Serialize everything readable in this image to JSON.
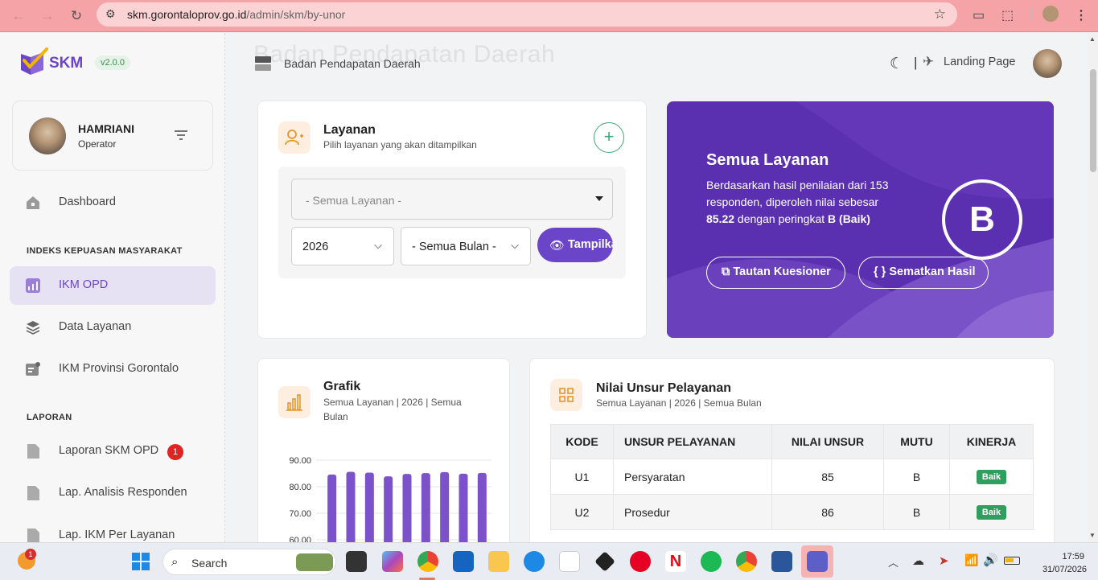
{
  "browser": {
    "url_host": "skm.gorontaloprov.go.id",
    "url_path": "/admin/skm/by-unor"
  },
  "sidebar": {
    "logo_text": "SKM",
    "version": "v2.0.0",
    "user": {
      "name": "HAMRIANI",
      "role": "Operator"
    },
    "items": [
      {
        "label": "Dashboard",
        "icon": "home-icon"
      },
      {
        "label": "IKM OPD",
        "icon": "chart-icon"
      },
      {
        "label": "Data Layanan",
        "icon": "layers-icon"
      },
      {
        "label": "IKM Provinsi Gorontalo",
        "icon": "doc-icon"
      },
      {
        "label": "Laporan SKM OPD",
        "icon": "file-icon",
        "badge": "1"
      },
      {
        "label": "Lap. Analisis Responden",
        "icon": "file-icon"
      },
      {
        "label": "Lap. IKM Per Layanan",
        "icon": "file-icon"
      }
    ],
    "section_ikm": "INDEKS KEPUASAN MASYARAKAT",
    "section_laporan": "LAPORAN"
  },
  "topbar": {
    "org_name": "Badan Pendapatan Daerah",
    "separator": "|",
    "landing_label": "Landing Page"
  },
  "layanan": {
    "title": "Layanan",
    "subtitle": "Pilih layanan yang akan ditampilkan",
    "add_symbol": "+",
    "service_select": "- Semua Layanan -",
    "year_select": "2026",
    "month_select": "- Semua Bulan -",
    "show_button": "Tampilkan"
  },
  "hero": {
    "title": "Semua Layanan",
    "text_1": "Berdasarkan hasil penilaian dari 153 responden, diperoleh nilai sebesar ",
    "score": "85.22",
    "text_2": " dengan peringkat ",
    "grade_text": "B (Baik)",
    "grade": "B",
    "button_kuesioner": "Tautan Kuesioner",
    "button_sematkan": "Sematkan Hasil",
    "accent": "#5a2fb0"
  },
  "grafik": {
    "title": "Grafik",
    "subtitle": "Semua Layanan | 2026 | Semua Bulan"
  },
  "chart_data": {
    "type": "bar",
    "y_ticks": [
      "90.00",
      "80.00",
      "70.00",
      "60.00"
    ],
    "ylim": [
      60,
      90
    ],
    "values": [
      84.6,
      85.6,
      85.3,
      83.9,
      84.8,
      85.1,
      85.5,
      84.9,
      85.2
    ],
    "color": "#7b52c9"
  },
  "unsur": {
    "title": "Nilai Unsur Pelayanan",
    "subtitle": "Semua Layanan | 2026 | Semua Bulan",
    "headers": [
      "KODE",
      "UNSUR PELAYANAN",
      "NILAI UNSUR",
      "MUTU",
      "KINERJA"
    ],
    "rows": [
      {
        "kode": "U1",
        "unsur": "Persyaratan",
        "nilai": "85",
        "mutu": "B",
        "kinerja": "Baik"
      },
      {
        "kode": "U2",
        "unsur": "Prosedur",
        "nilai": "86",
        "mutu": "B",
        "kinerja": "Baik"
      }
    ]
  },
  "taskbar": {
    "search_placeholder": "Search",
    "time": "17:59",
    "date": "31/07/2026",
    "notif_count": "1"
  }
}
